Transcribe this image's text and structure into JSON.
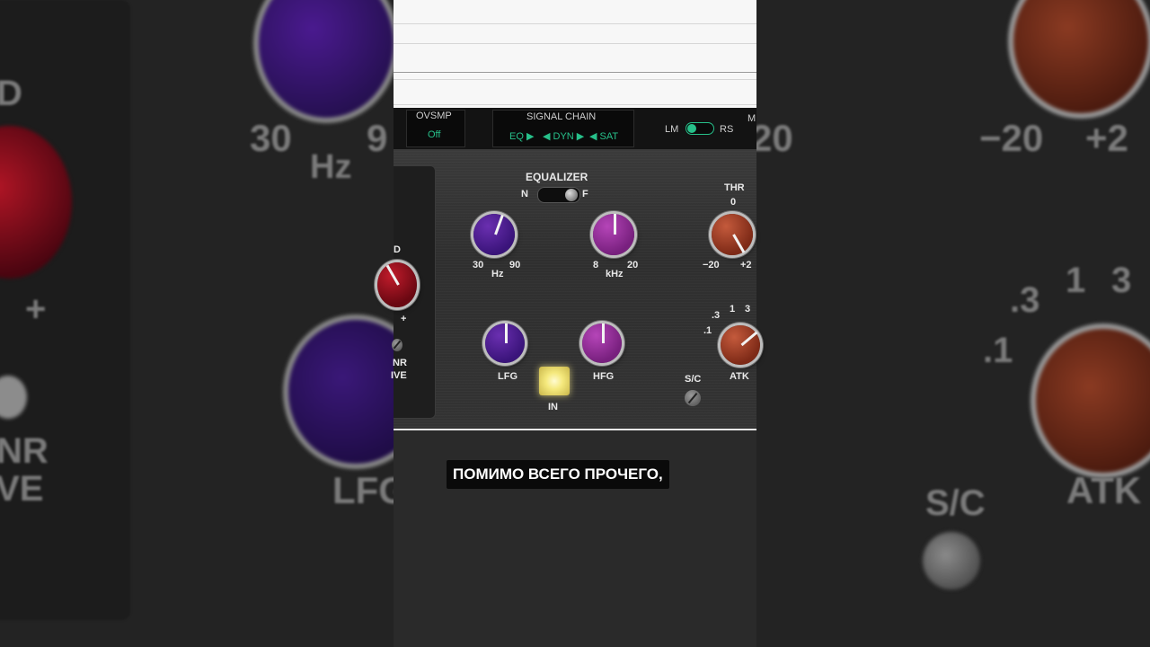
{
  "header": {
    "ovsmp_label": "OVSMP",
    "ovsmp_value": "Off",
    "signal_chain_label": "SIGNAL CHAIN",
    "chain": [
      "EQ ▶",
      "◀ DYN ▶",
      "◀ SAT"
    ],
    "lm_label": "LM",
    "rs_label": "RS",
    "cut_label": "M"
  },
  "equalizer": {
    "title": "EQUALIZER",
    "n_label": "N",
    "f_label": "F",
    "low_freq": {
      "min": "30",
      "max": "90",
      "unit": "Hz"
    },
    "high_freq": {
      "min": "8",
      "max": "20",
      "unit": "kHz"
    },
    "lfg_label": "LFG",
    "hfg_label": "HFG",
    "in_label": "IN"
  },
  "dynamics": {
    "thr_label": "THR",
    "thr_zero": "0",
    "thr_min": "−20",
    "thr_max": "+2",
    "atk_ticks": [
      ".1",
      ".3",
      "1",
      "3"
    ],
    "atk_label": "ATK",
    "sc_label": "S/C"
  },
  "side": {
    "d_label": "D",
    "plus": "+",
    "nr_label": "NR",
    "drive_label": "IVE"
  },
  "background": {
    "left_30": "30",
    "left_9": "9",
    "left_hz": "Hz",
    "left_d": "D",
    "left_plus": "+",
    "left_nr": "NR",
    "left_ive": "IVE",
    "left_lfg": "LFG",
    "right_minus20": "−20",
    "right_plus2": "+2",
    "right_20": "20",
    "right_ticks": [
      ".1",
      ".3",
      "1",
      "3"
    ],
    "right_sc": "S/C",
    "right_atk": "ATK"
  },
  "caption": "ПОМИМО ВСЕГО ПРОЧЕГО,",
  "colors": {
    "accent_green": "#27c08a",
    "purple_knob": "#4a1a8f",
    "magenta_knob": "#9a2a9e",
    "orange_knob": "#a0401f",
    "led_yellow": "#f5e97d"
  }
}
